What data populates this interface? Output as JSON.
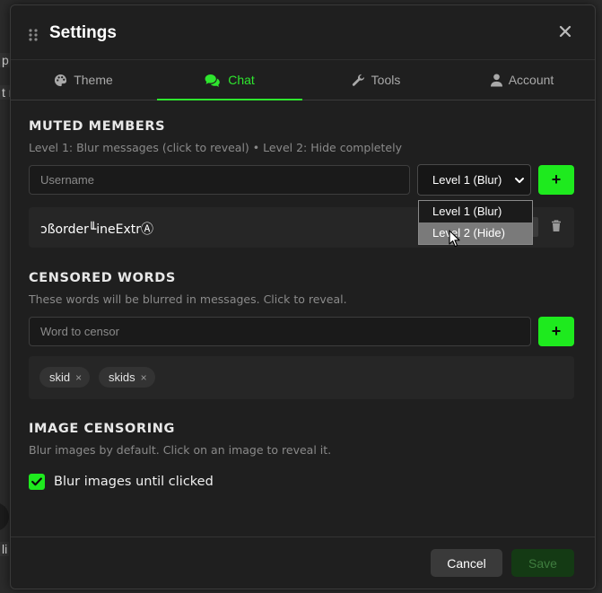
{
  "background": {
    "fragments": [
      "p",
      "t r",
      "li"
    ]
  },
  "modal": {
    "title": "Settings",
    "tabs": [
      {
        "label": "Theme",
        "icon": "palette-icon"
      },
      {
        "label": "Chat",
        "icon": "comments-icon",
        "active": true
      },
      {
        "label": "Tools",
        "icon": "wrench-icon"
      },
      {
        "label": "Account",
        "icon": "user-icon"
      }
    ]
  },
  "muted": {
    "title": "MUTED MEMBERS",
    "description": "Level 1: Blur messages (click to reveal) • Level 2: Hide completely",
    "username_placeholder": "Username",
    "selected_level": "Level 1 (Blur)",
    "options": [
      "Level 1 (Blur)",
      "Level 2 (Hide)"
    ],
    "add_label": "+",
    "members": [
      {
        "name": "ↄßorder╙ineExtrⒶ"
      }
    ]
  },
  "censored": {
    "title": "CENSORED WORDS",
    "description": "These words will be blurred in messages. Click to reveal.",
    "placeholder": "Word to censor",
    "add_label": "+",
    "words": [
      "skid",
      "skids"
    ],
    "remove_glyph": "×"
  },
  "images": {
    "title": "IMAGE CENSORING",
    "description": "Blur images by default. Click on an image to reveal it.",
    "checkbox_label": "Blur images until clicked",
    "checked": true
  },
  "footer": {
    "cancel_label": "Cancel",
    "save_label": "Save"
  },
  "colors": {
    "accent": "#1eea1e",
    "active_tab": "#2ee62e",
    "panel": "#1f1f1f"
  }
}
